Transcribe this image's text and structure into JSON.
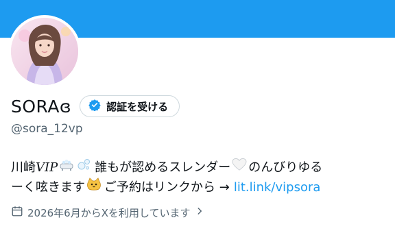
{
  "profile": {
    "display_name": "SORAɞ",
    "handle": "@sora_12vp",
    "verify_button_label": "認証を受ける",
    "bio": {
      "line1_prefix": "川崎",
      "line1_vip": "VIP",
      "line1_text": "誰もが認めるスレンダー",
      "line1_suffix": "のんびりゆる",
      "line2_text": "ーく呟きます",
      "line2_text2": "ご予約はリンクから →",
      "link": "lit.link/vipsora"
    },
    "joined_text": "2026年6月からXを利用しています"
  },
  "icons": {
    "avatar": "profile-photo",
    "verify": "verified-badge-icon",
    "bath": "bathtub-emoji",
    "bubbles": "bubbles-emoji",
    "heart": "white-heart-emoji",
    "cat": "cat-emoji",
    "calendar": "calendar-icon",
    "chevron": "chevron-right-icon"
  },
  "colors": {
    "banner": "#1d9bf0",
    "link": "#1d9bf0",
    "secondary_text": "#536471"
  }
}
